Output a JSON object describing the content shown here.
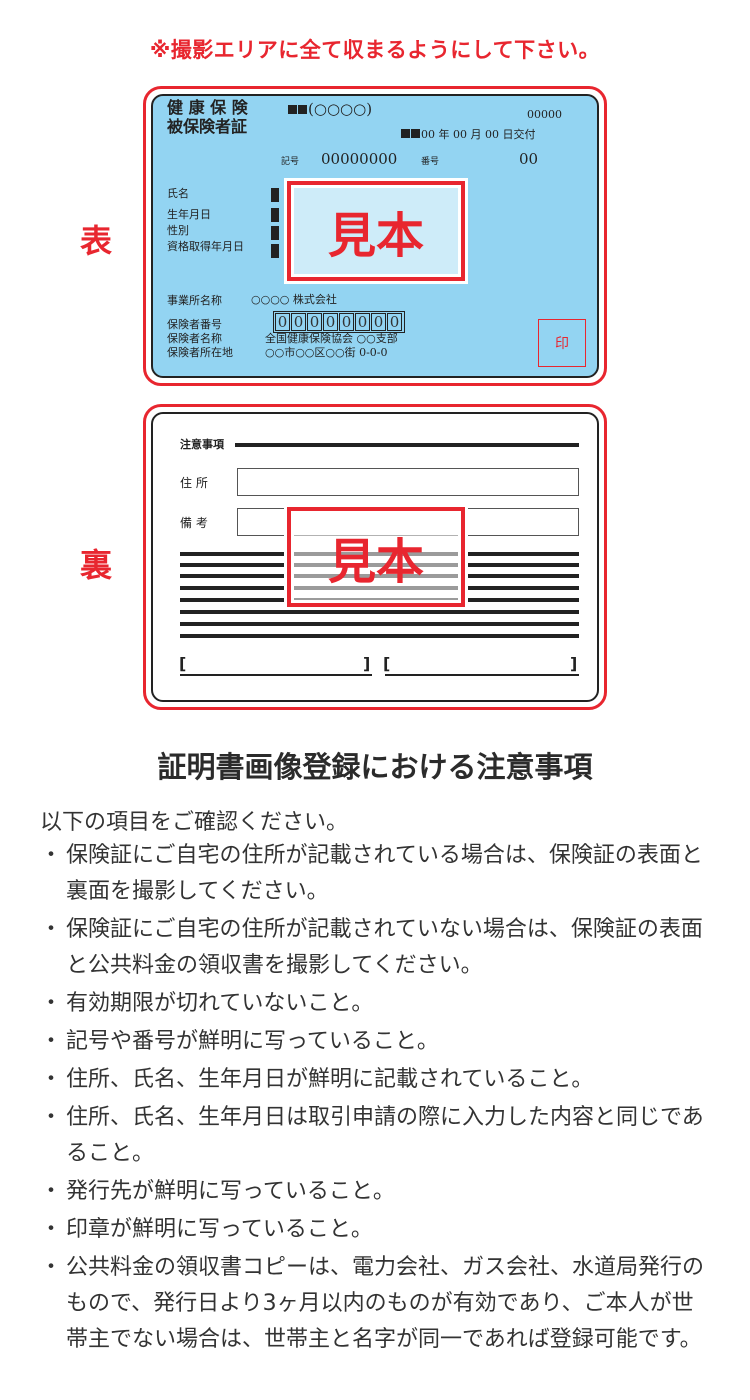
{
  "notice": "※撮影エリアに全て収まるようにして下さい。",
  "front_label": "表",
  "back_label": "裏",
  "sample_stamp": "見本",
  "card_front": {
    "title_line1": "健 康 保 険",
    "title_line2": "被保険者証",
    "insurer_header": "(○○○○)",
    "serial": "00000",
    "issued": "00 年 00 月 00 日交付",
    "kigo_label": "記号",
    "kigo_value": "00000000",
    "bango_label": "番号",
    "bango_value": "00",
    "name_label": "氏名",
    "birth_label": "生年月日",
    "sex_label": "性別",
    "qualified_label": "資格取得年月日",
    "company_label": "事業所名称",
    "company_value": "○○○○ 株式会社",
    "insurer_no_label": "保険者番号",
    "insurer_no_digits": [
      "0",
      "0",
      "0",
      "0",
      "0",
      "0",
      "0",
      "0"
    ],
    "insurer_name_label": "保険者名称",
    "insurer_name_value": "全国健康保険協会 ○○支部",
    "insurer_addr_label": "保険者所在地",
    "insurer_addr_value": "○○市○○区○○街 0-0-0",
    "seal": "印"
  },
  "card_back": {
    "notes_label": "注意事項",
    "address_label": "住 所",
    "remarks_label": "備 考",
    "bracket_open": "[",
    "bracket_close": "]"
  },
  "section_title": "証明書画像登録における注意事項",
  "intro": "以下の項目をご確認ください。",
  "notes": [
    "保険証にご自宅の住所が記載されている場合は、保険証の表面と裏面を撮影してください。",
    "保険証にご自宅の住所が記載されていない場合は、保険証の表面と公共料金の領収書を撮影してください。",
    "有効期限が切れていないこと。",
    "記号や番号が鮮明に写っていること。",
    "住所、氏名、生年月日が鮮明に記載されていること。",
    "住所、氏名、生年月日は取引申請の際に入力した内容と同じであること。",
    "発行先が鮮明に写っていること。",
    "印章が鮮明に写っていること。",
    "公共料金の領収書コピーは、電力会社、ガス会社、水道局発行のもので、発行日より3ヶ月以内のものが有効であり、ご本人が世帯主でない場合は、世帯主と名字が同一であれば登録可能です。"
  ],
  "colors": {
    "accent_red": "#e8262f",
    "card_blue": "#93d4f2"
  }
}
